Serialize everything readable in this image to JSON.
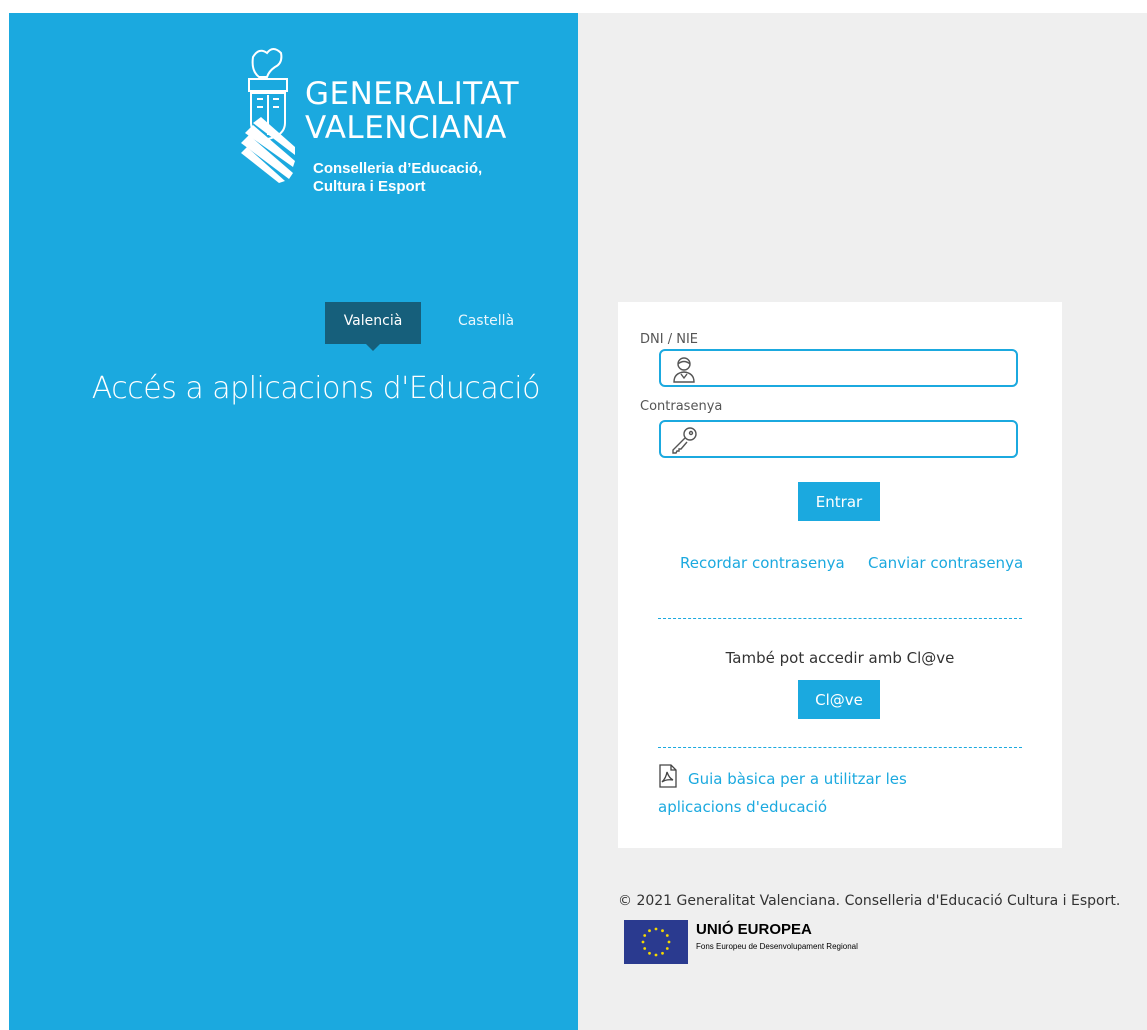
{
  "branding": {
    "org_line1": "GENERALITAT",
    "org_line2": "VALENCIANA",
    "dept_line1": "Conselleria d’Educació,",
    "dept_line2": "Cultura i Esport"
  },
  "language_tabs": [
    {
      "label": "Valencià",
      "active": true
    },
    {
      "label": "Castellà",
      "active": false
    }
  ],
  "page_title": "Accés a aplicacions d'Educació",
  "login": {
    "user_label": "DNI / NIE",
    "user_value": "",
    "password_label": "Contrasenya",
    "password_value": "",
    "submit_label": "Entrar",
    "remember_link": "Recordar contrasenya",
    "change_link": "Canviar contrasenya",
    "also_text": "També pot accedir amb Cl@ve",
    "clave_label": "Cl@ve",
    "guide_link": "Guia bàsica per a utilitzar les aplicacions d'educació"
  },
  "footer": {
    "copyright": "© 2021 Generalitat Valenciana. Conselleria d'Educació Cultura i Esport.",
    "eu_title": "UNIÓ EUROPEA",
    "eu_subtitle": "Fons Europeu de Desenvolupament Regional"
  },
  "colors": {
    "brand_blue": "#1ba9df",
    "tab_active": "#165f7b",
    "right_bg": "#efefef",
    "eu_blue": "#2a3a8f"
  },
  "icons": {
    "user_field": "user-icon",
    "password_field": "key-icon",
    "guide": "pdf-file-icon",
    "logo": "generalitat-crest-icon",
    "eu": "eu-flag-icon"
  }
}
